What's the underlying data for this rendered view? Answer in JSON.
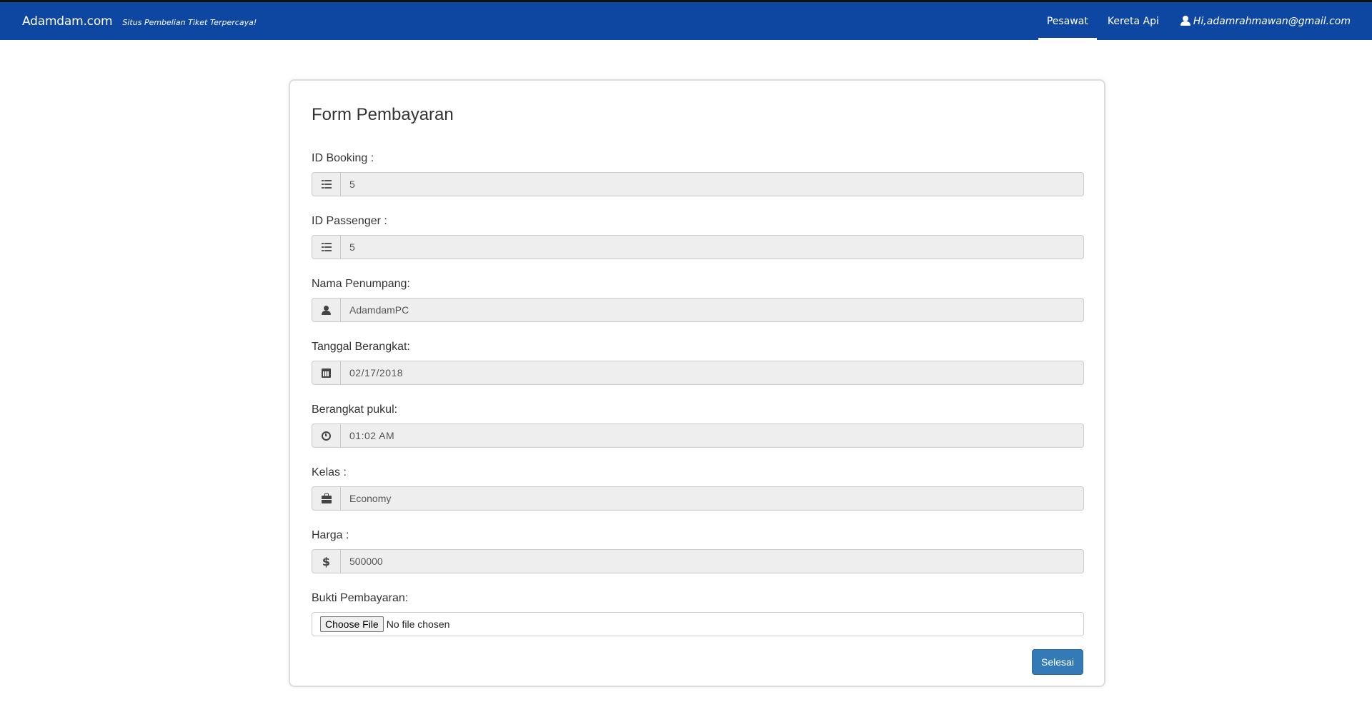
{
  "navbar": {
    "brand": "Adamdam.com",
    "tagline": "Situs Pembelian Tiket Terpercaya!",
    "items": [
      {
        "label": "Pesawat",
        "active": true
      },
      {
        "label": "Kereta Api",
        "active": false
      }
    ],
    "user_label": "Hi,adamrahmawan@gmail.com",
    "bg_color": "#0d47a1"
  },
  "form": {
    "title": "Form Pembayaran",
    "fields": [
      {
        "label": "ID Booking :",
        "value": "5",
        "icon": "list-icon"
      },
      {
        "label": "ID Passenger :",
        "value": "5",
        "icon": "list-icon"
      },
      {
        "label": "Nama Penumpang:",
        "value": "AdamdamPC",
        "icon": "user-icon"
      },
      {
        "label": "Tanggal Berangkat:",
        "value": "02/17/2018",
        "icon": "calendar-icon"
      },
      {
        "label": "Berangkat pukul:",
        "value": "01:02 AM",
        "icon": "clock-icon"
      },
      {
        "label": "Kelas :",
        "value": "Economy",
        "icon": "briefcase-icon"
      },
      {
        "label": "Harga :",
        "value": "500000",
        "icon": "dollar-icon"
      }
    ],
    "upload": {
      "label": "Bukti Pembayaran:",
      "button_label": "Choose File",
      "status": "No file chosen"
    },
    "submit_label": "Selesai",
    "submit_color": "#337ab7"
  }
}
